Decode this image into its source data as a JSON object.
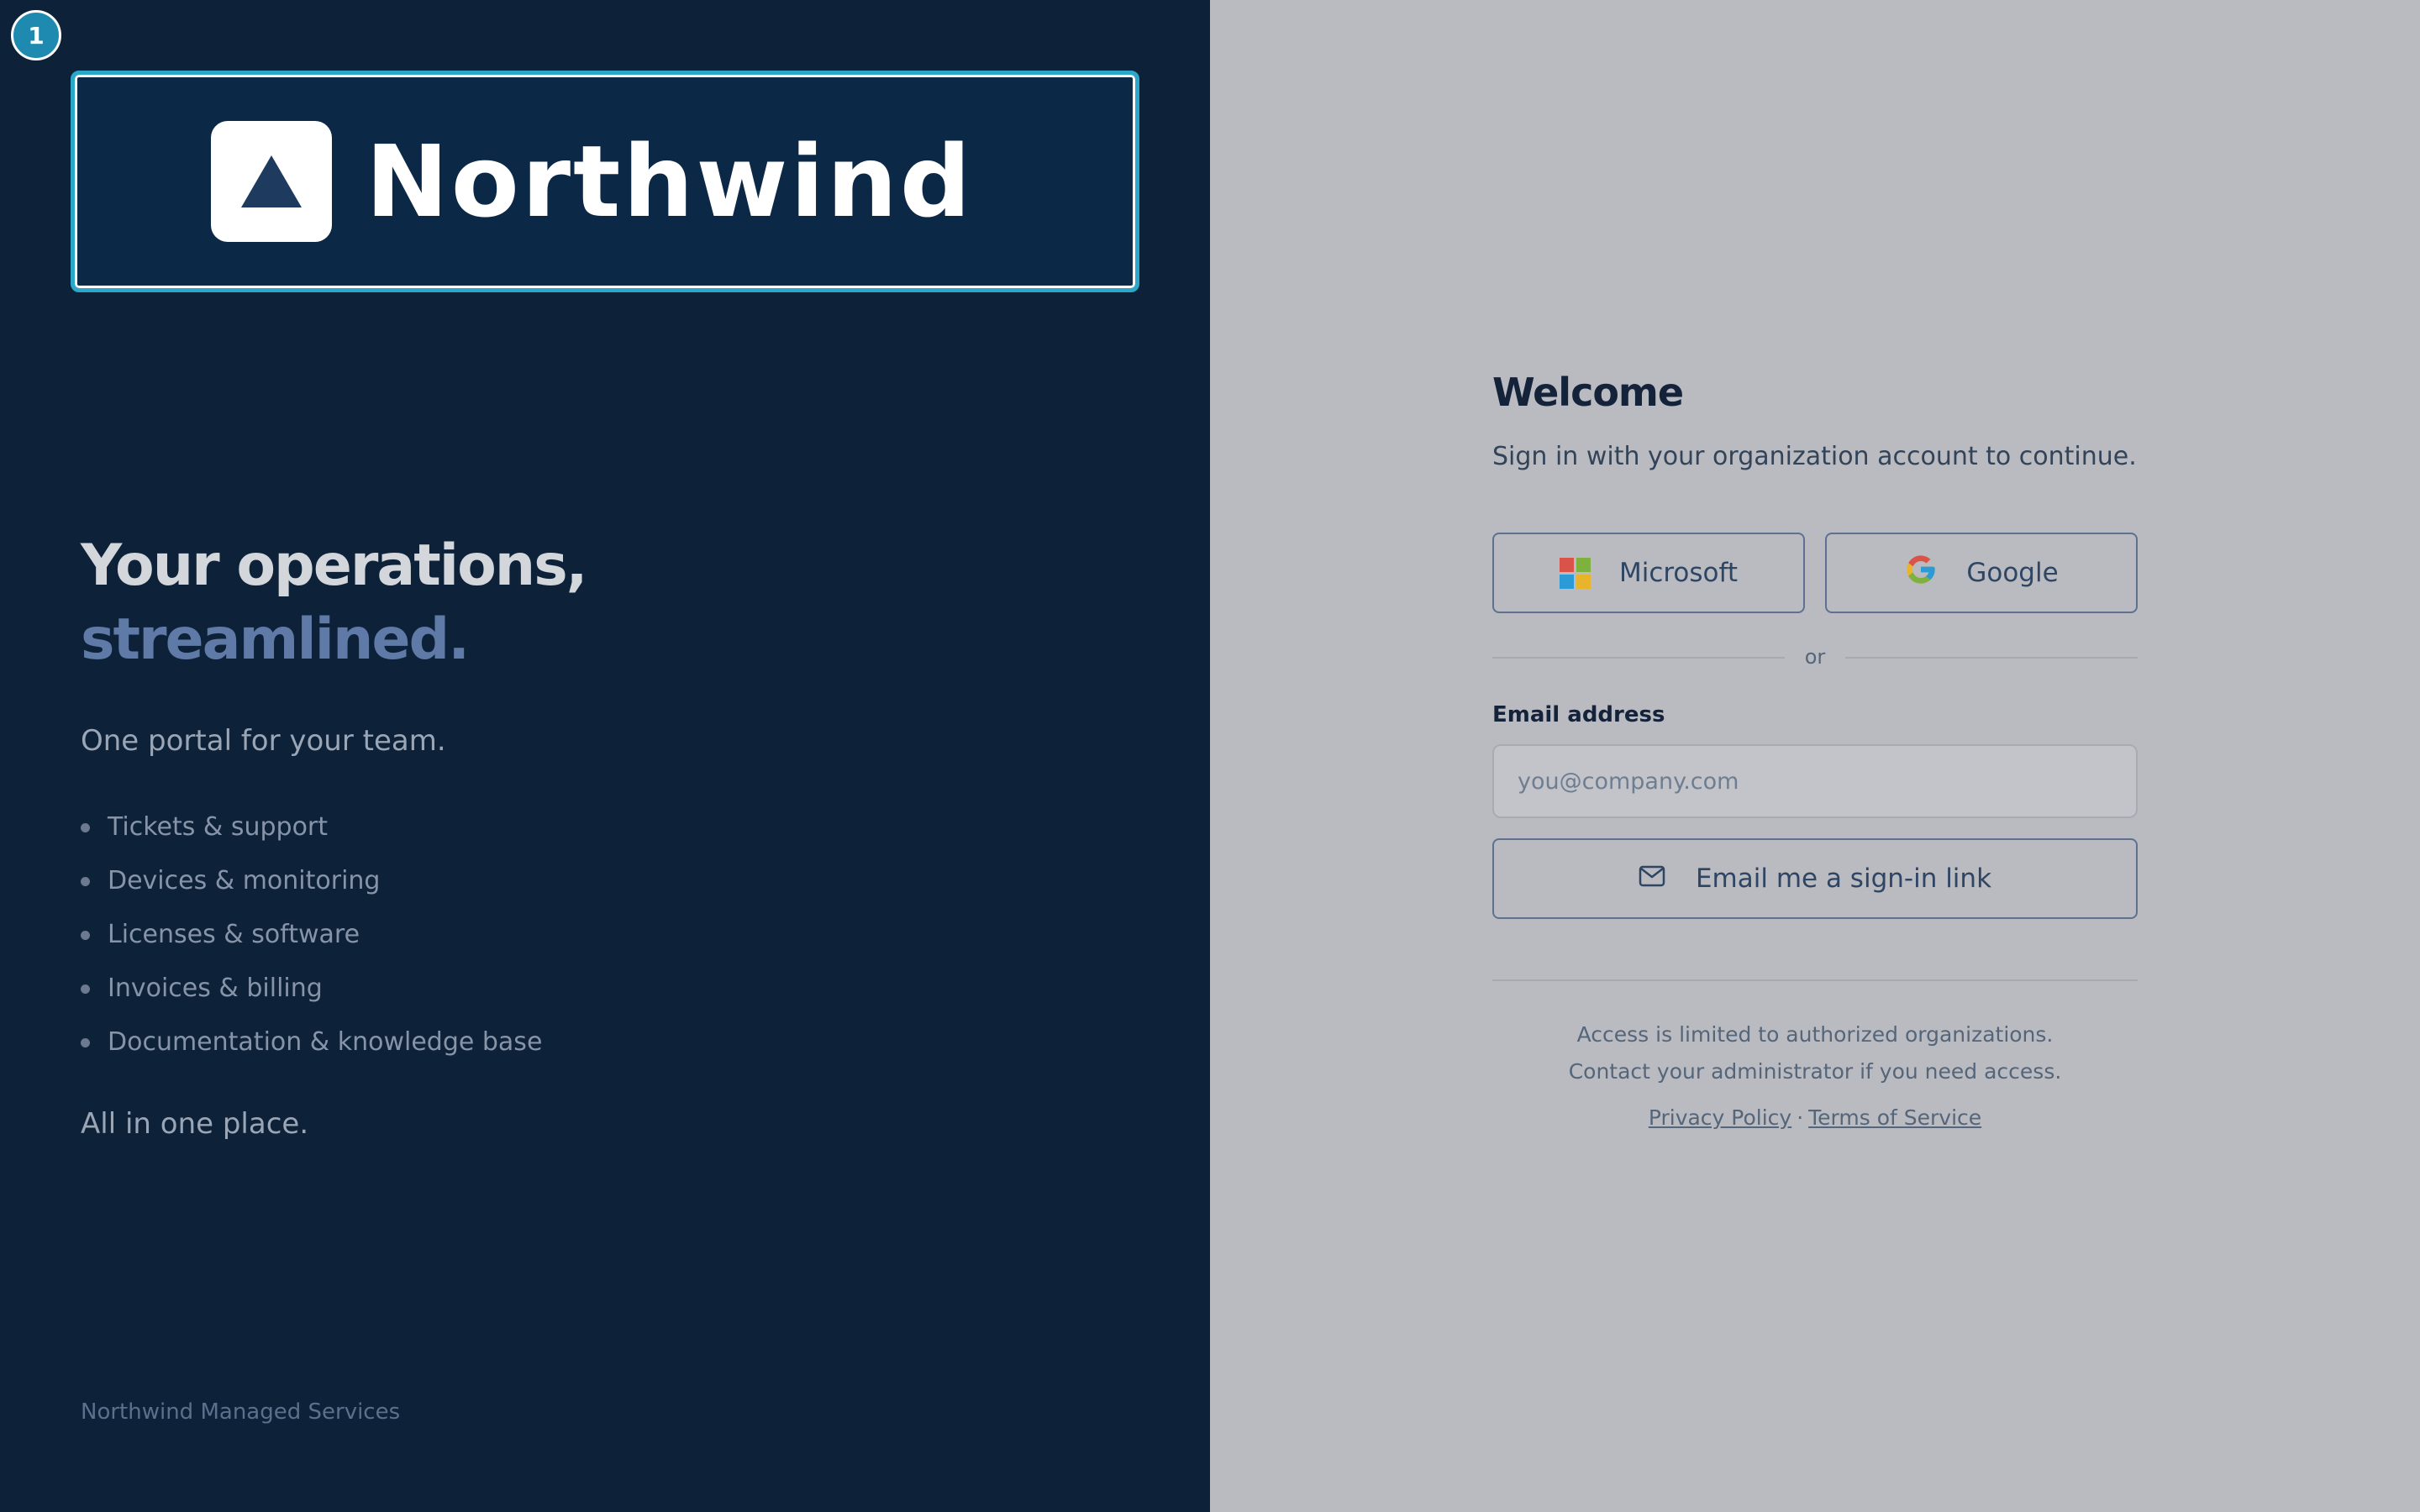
{
  "overlay": {
    "step_badge": "1"
  },
  "brand": {
    "logo_text": "Northwind",
    "headline_line1": "Your operations,",
    "headline_line2": "streamlined.",
    "tagline": "One portal for your team.",
    "features": [
      "Tickets & support",
      "Devices & monitoring",
      "Licenses & software",
      "Invoices & billing",
      "Documentation & knowledge base"
    ],
    "closing": "All in one place.",
    "footer": "Northwind Managed Services"
  },
  "signin": {
    "title": "Welcome",
    "subtitle": "Sign in with your organization account to continue.",
    "sso": {
      "microsoft_label": "Microsoft",
      "google_label": "Google"
    },
    "divider_text": "or",
    "email_label": "Email address",
    "email_value": "",
    "email_placeholder": "you@company.com",
    "magic_link_label": "Email me a sign-in link",
    "notice_line1": "Access is limited to authorized organizations.",
    "notice_line2": "Contact your administrator if you need access.",
    "legal": {
      "privacy_label": "Privacy Policy",
      "separator": "·",
      "terms_label": "Terms of Service"
    }
  },
  "icons": {
    "logo": "triangle-logo-icon",
    "microsoft": "microsoft-icon",
    "google": "google-icon",
    "mail": "mail-icon"
  },
  "colors": {
    "left_panel_bg": "#0d2239",
    "right_panel_bg": "#b9bbc0",
    "accent_cyan": "#2aa7c9",
    "logo_triangle": "#1f3a5f",
    "ms_red": "#d9534a",
    "ms_green": "#7fb13f",
    "ms_blue": "#2a9bd6",
    "ms_yellow": "#e8b42c"
  }
}
